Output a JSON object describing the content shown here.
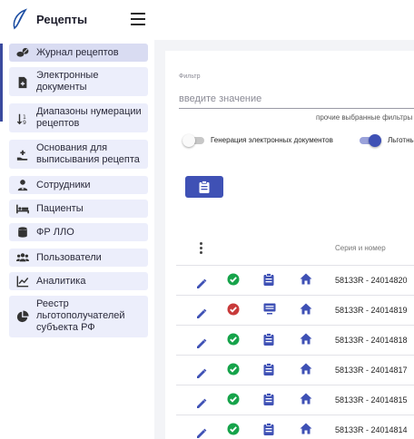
{
  "app": {
    "title": "Рецепты",
    "logo": "feather-logo-icon",
    "menu_icon": "hamburger-icon"
  },
  "colors": {
    "primary": "#3f51b5",
    "sidebar_item_bg": "#eceefb",
    "sidebar_active_bg": "#d9dcf2",
    "status_ok": "#16a34a",
    "status_error": "#c83a3a"
  },
  "sidebar": {
    "items": [
      {
        "label": "Журнал рецептов",
        "icon": "pills-icon",
        "active": true
      },
      {
        "label": "Электронные документы",
        "icon": "file-plus-icon"
      },
      {
        "label": "Диапазоны нумерации рецептов",
        "icon": "sort-numbers-icon"
      },
      {
        "label": "Основания для выписывания рецепта",
        "icon": "hand-medical-icon"
      },
      {
        "label": "Сотрудники",
        "icon": "doctor-icon"
      },
      {
        "label": "Пациенты",
        "icon": "bed-icon"
      },
      {
        "label": "ФР ЛЛО",
        "icon": "database-icon"
      },
      {
        "label": "Пользователи",
        "icon": "users-icon"
      },
      {
        "label": "Аналитика",
        "icon": "line-chart-icon"
      },
      {
        "label": "Реестр льготополучателей субъекта РФ",
        "icon": "pie-chart-icon"
      }
    ]
  },
  "filter": {
    "label": "Фильтр",
    "placeholder": "введите значение",
    "value": "",
    "other_filters": "прочие выбранные фильтры",
    "toggles": [
      {
        "label": "Генерация электронных документов",
        "on": false
      },
      {
        "label": "Льготные",
        "on": true
      }
    ],
    "action_icon": "clipboard-icon"
  },
  "table": {
    "menu_icon": "kebab-icon",
    "column_serial": "Серия и номер",
    "rows": [
      {
        "status": "ok",
        "doc_icon": "clipboard-icon",
        "serial": "58133R - 24014820"
      },
      {
        "status": "error",
        "doc_icon": "monitor-icon",
        "serial": "58133R - 24014819"
      },
      {
        "status": "ok",
        "doc_icon": "clipboard-icon",
        "serial": "58133R - 24014818"
      },
      {
        "status": "ok",
        "doc_icon": "clipboard-icon",
        "serial": "58133R - 24014817"
      },
      {
        "status": "ok",
        "doc_icon": "clipboard-icon",
        "serial": "58133R - 24014815"
      },
      {
        "status": "ok",
        "doc_icon": "clipboard-icon",
        "serial": "58133R - 24014814"
      }
    ]
  }
}
